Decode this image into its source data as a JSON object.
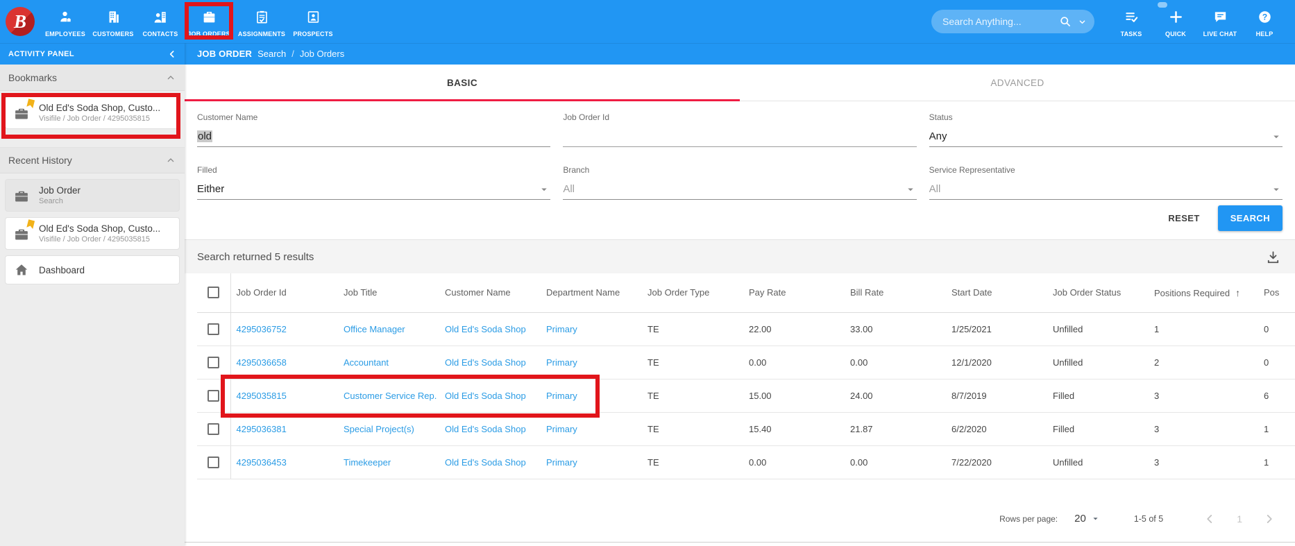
{
  "topnav": {
    "logo_letter": "B",
    "items": [
      {
        "label": "EMPLOYEES"
      },
      {
        "label": "CUSTOMERS"
      },
      {
        "label": "CONTACTS"
      },
      {
        "label": "JOB ORDERS"
      },
      {
        "label": "ASSIGNMENTS"
      },
      {
        "label": "PROSPECTS"
      }
    ],
    "search_placeholder": "Search Anything...",
    "right_items": [
      {
        "label": "TASKS"
      },
      {
        "label": "QUICK"
      },
      {
        "label": "LIVE CHAT"
      },
      {
        "label": "HELP"
      }
    ]
  },
  "breadcrumb": {
    "section": "JOB ORDER",
    "subsection": "Search",
    "separator": "/",
    "current": "Job Orders"
  },
  "sidebar": {
    "header": "ACTIVITY PANEL",
    "bookmarks": {
      "title": "Bookmarks",
      "item": {
        "title": "Old Ed's Soda Shop, Custo...",
        "subtitle": "Visifile / Job Order / 4295035815"
      }
    },
    "recent_history": {
      "title": "Recent History",
      "items": [
        {
          "title": "Job Order",
          "subtitle": "Search"
        },
        {
          "title": "Old Ed's Soda Shop, Custo...",
          "subtitle": "Visifile / Job Order / 4295035815"
        },
        {
          "title": "Dashboard",
          "subtitle": ""
        }
      ]
    }
  },
  "search_form": {
    "tabs": [
      {
        "label": "BASIC",
        "active": true
      },
      {
        "label": "ADVANCED",
        "active": false
      }
    ],
    "fields": {
      "customer_name": {
        "label": "Customer Name",
        "value": "old"
      },
      "job_order_id": {
        "label": "Job Order Id",
        "value": ""
      },
      "status": {
        "label": "Status",
        "value": "Any"
      },
      "filled": {
        "label": "Filled",
        "value": "Either"
      },
      "branch": {
        "label": "Branch",
        "value": "All"
      },
      "service_representative": {
        "label": "Service Representative",
        "value": "All"
      }
    },
    "buttons": {
      "reset": "RESET",
      "search": "SEARCH"
    }
  },
  "results": {
    "summary": "Search returned 5 results",
    "columns": [
      "Job Order Id",
      "Job Title",
      "Customer Name",
      "Department Name",
      "Job Order Type",
      "Pay Rate",
      "Bill Rate",
      "Start Date",
      "Job Order Status",
      "Positions Required",
      "Pos"
    ],
    "sort": {
      "column": "Positions Required",
      "direction": "asc"
    },
    "link_columns": [
      0,
      1,
      2,
      3
    ],
    "rows": [
      [
        "4295036752",
        "Office Manager",
        "Old Ed's Soda Shop",
        "Primary",
        "TE",
        "22.00",
        "33.00",
        "1/25/2021",
        "Unfilled",
        "1",
        "0"
      ],
      [
        "4295036658",
        "Accountant",
        "Old Ed's Soda Shop",
        "Primary",
        "TE",
        "0.00",
        "0.00",
        "12/1/2020",
        "Unfilled",
        "2",
        "0"
      ],
      [
        "4295035815",
        "Customer Service Rep.",
        "Old Ed's Soda Shop",
        "Primary",
        "TE",
        "15.00",
        "24.00",
        "8/7/2019",
        "Filled",
        "3",
        "6"
      ],
      [
        "4295036381",
        "Special Project(s)",
        "Old Ed's Soda Shop",
        "Primary",
        "TE",
        "15.40",
        "21.87",
        "6/2/2020",
        "Filled",
        "3",
        "1"
      ],
      [
        "4295036453",
        "Timekeeper",
        "Old Ed's Soda Shop",
        "Primary",
        "TE",
        "0.00",
        "0.00",
        "7/22/2020",
        "Unfilled",
        "3",
        "1"
      ]
    ],
    "pagination": {
      "rows_per_page_label": "Rows per page:",
      "rows_per_page": "20",
      "range": "1-5 of 5",
      "current_page": "1"
    }
  },
  "annotations": {
    "color": "#e1151b",
    "targets": [
      "job-orders-nav-item",
      "bookmark-card",
      "result-row-4295035815"
    ]
  },
  "colors": {
    "topbar_blue": "#2196f3",
    "annotation_red": "#e1151b",
    "link_blue": "#2b9ce5",
    "tab_underline_red": "#ef1d43",
    "search_button_blue": "#2196f3",
    "bookmark_flag_yellow": "#f2b218"
  }
}
